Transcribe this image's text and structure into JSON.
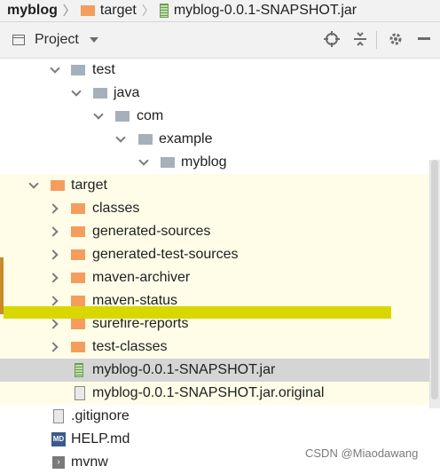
{
  "breadcrumb": {
    "items": [
      "myblog",
      "target",
      "myblog-0.0.1-SNAPSHOT.jar"
    ]
  },
  "toolbar": {
    "title": "Project",
    "buttons": [
      "locate-icon",
      "collapse-all-icon",
      "gear-icon",
      "hide-icon"
    ]
  },
  "tree": {
    "rows": [
      {
        "label": "test",
        "icon": "folder-icon",
        "expanded": true
      },
      {
        "label": "java",
        "icon": "folder-icon",
        "expanded": true
      },
      {
        "label": "com",
        "icon": "folder-icon",
        "expanded": true
      },
      {
        "label": "example",
        "icon": "folder-icon",
        "expanded": true
      },
      {
        "label": "myblog",
        "icon": "folder-icon",
        "expanded": true
      },
      {
        "label": "target",
        "icon": "folder-icon",
        "expanded": true
      },
      {
        "label": "classes",
        "icon": "folder-icon",
        "expanded": false
      },
      {
        "label": "generated-sources",
        "icon": "folder-icon",
        "expanded": false
      },
      {
        "label": "generated-test-sources",
        "icon": "folder-icon",
        "expanded": false
      },
      {
        "label": "maven-archiver",
        "icon": "folder-icon",
        "expanded": false
      },
      {
        "label": "maven-status",
        "icon": "folder-icon",
        "expanded": false
      },
      {
        "label": "surefire-reports",
        "icon": "folder-icon",
        "expanded": false
      },
      {
        "label": "test-classes",
        "icon": "folder-icon",
        "expanded": false
      },
      {
        "label": "myblog-0.0.1-SNAPSHOT.jar",
        "icon": "jar-icon",
        "selected": true
      },
      {
        "label": "myblog-0.0.1-SNAPSHOT.jar.original",
        "icon": "unknown-file-icon"
      },
      {
        "label": ".gitignore",
        "icon": "gitignore-icon"
      },
      {
        "label": "HELP.md",
        "icon": "md-icon",
        "badge": "MD"
      },
      {
        "label": "mvnw",
        "icon": "shell-icon"
      }
    ]
  },
  "watermark": "CSDN @Miaodawang",
  "colors": {
    "folder_gray": "#a6b0ba",
    "folder_orange": "#f59d5c",
    "highlight_row": "#fffde8",
    "selection": "#d5d5d5",
    "marker": "#d8d800"
  }
}
